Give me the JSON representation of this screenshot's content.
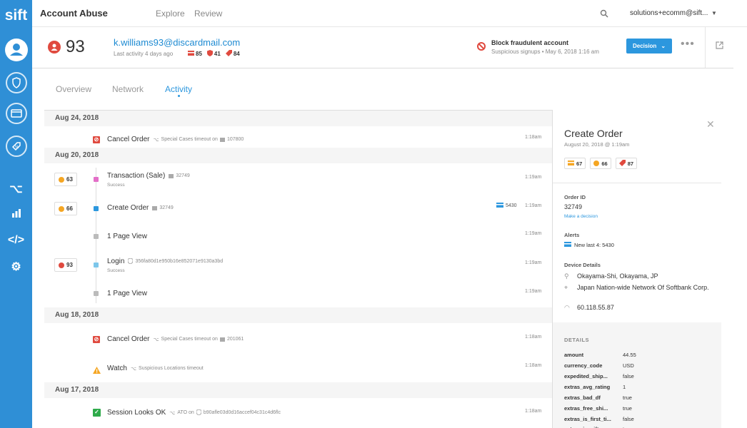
{
  "app": {
    "logo": "sift",
    "title": "Account Abuse",
    "nav": [
      "Explore",
      "Review"
    ],
    "user_account": "solutions+ecomm@sift..."
  },
  "colors": {
    "accent": "#2c97de",
    "sidebar": "#2f8fd6",
    "danger": "#e04a3f",
    "warning": "#f5a623",
    "success": "#2eaa4a"
  },
  "header": {
    "score": "93",
    "email": "k.williams93@discardmail.com",
    "last_activity": "Last activity 4 days ago",
    "mini_scores": [
      "85",
      "41",
      "84"
    ],
    "decision_title": "Block fraudulent account",
    "decision_sub": "Suspicious signups • May 6, 2018 1:16 am",
    "decision_button": "Decision"
  },
  "tabs": [
    "Overview",
    "Network",
    "Activity"
  ],
  "feed": {
    "days": [
      "Aug 24, 2018",
      "Aug 20, 2018",
      "Aug 18, 2018",
      "Aug 17, 2018"
    ],
    "rows": [
      {
        "title": "Cancel Order",
        "meta_a": "Special Cases timeout on",
        "meta_b": "107800",
        "time": "1:18am"
      },
      {
        "title": "Transaction (Sale)",
        "meta_b": "32749",
        "sub": "Success",
        "score": "63",
        "time": "1:19am"
      },
      {
        "title": "Create Order",
        "meta_b": "32749",
        "score": "66",
        "extra": "5430",
        "time": "1:19am"
      },
      {
        "title": "1 Page View",
        "time": "1:19am"
      },
      {
        "title": "Login",
        "meta_b": "356fa80d1e950b16e852071e9130a3bd",
        "sub": "Success",
        "score": "93",
        "time": "1:19am"
      },
      {
        "title": "1 Page View",
        "time": "1:19am"
      },
      {
        "title": "Cancel Order",
        "meta_a": "Special Cases timeout on",
        "meta_b": "201061",
        "time": "1:18am"
      },
      {
        "title": "Watch",
        "meta_a": "Suspicious Locations timeout",
        "time": "1:18am"
      },
      {
        "title": "Session Looks OK",
        "meta_a": "ATO on",
        "meta_b": "b90afle03d0d16accef04c31c4d6flc",
        "time": "1:18am"
      }
    ]
  },
  "panel": {
    "title": "Create Order",
    "date": "August 20, 2018 @ 1:19am",
    "scores": [
      "67",
      "66",
      "87"
    ],
    "order_label": "Order ID",
    "order_id": "32749",
    "decision_link": "Make a decision",
    "alerts_label": "Alerts",
    "alert": "New last 4: 5430",
    "device_label": "Device Details",
    "location": "Okayama-Shi, Okayama, JP",
    "network": "Japan Nation-wide Network Of Softbank Corp.",
    "ip": "60.118.55.87",
    "details_label": "DETAILS",
    "details": [
      {
        "k": "amount",
        "v": "44.55"
      },
      {
        "k": "currency_code",
        "v": "USD"
      },
      {
        "k": "expedited_ship...",
        "v": "false"
      },
      {
        "k": "extras_avg_rating",
        "v": "1"
      },
      {
        "k": "extras_bad_df",
        "v": "true"
      },
      {
        "k": "extras_free_shi...",
        "v": "true"
      },
      {
        "k": "extras_is_first_ti...",
        "v": "false"
      },
      {
        "k": "extras_is_gift",
        "v": "true"
      }
    ]
  }
}
